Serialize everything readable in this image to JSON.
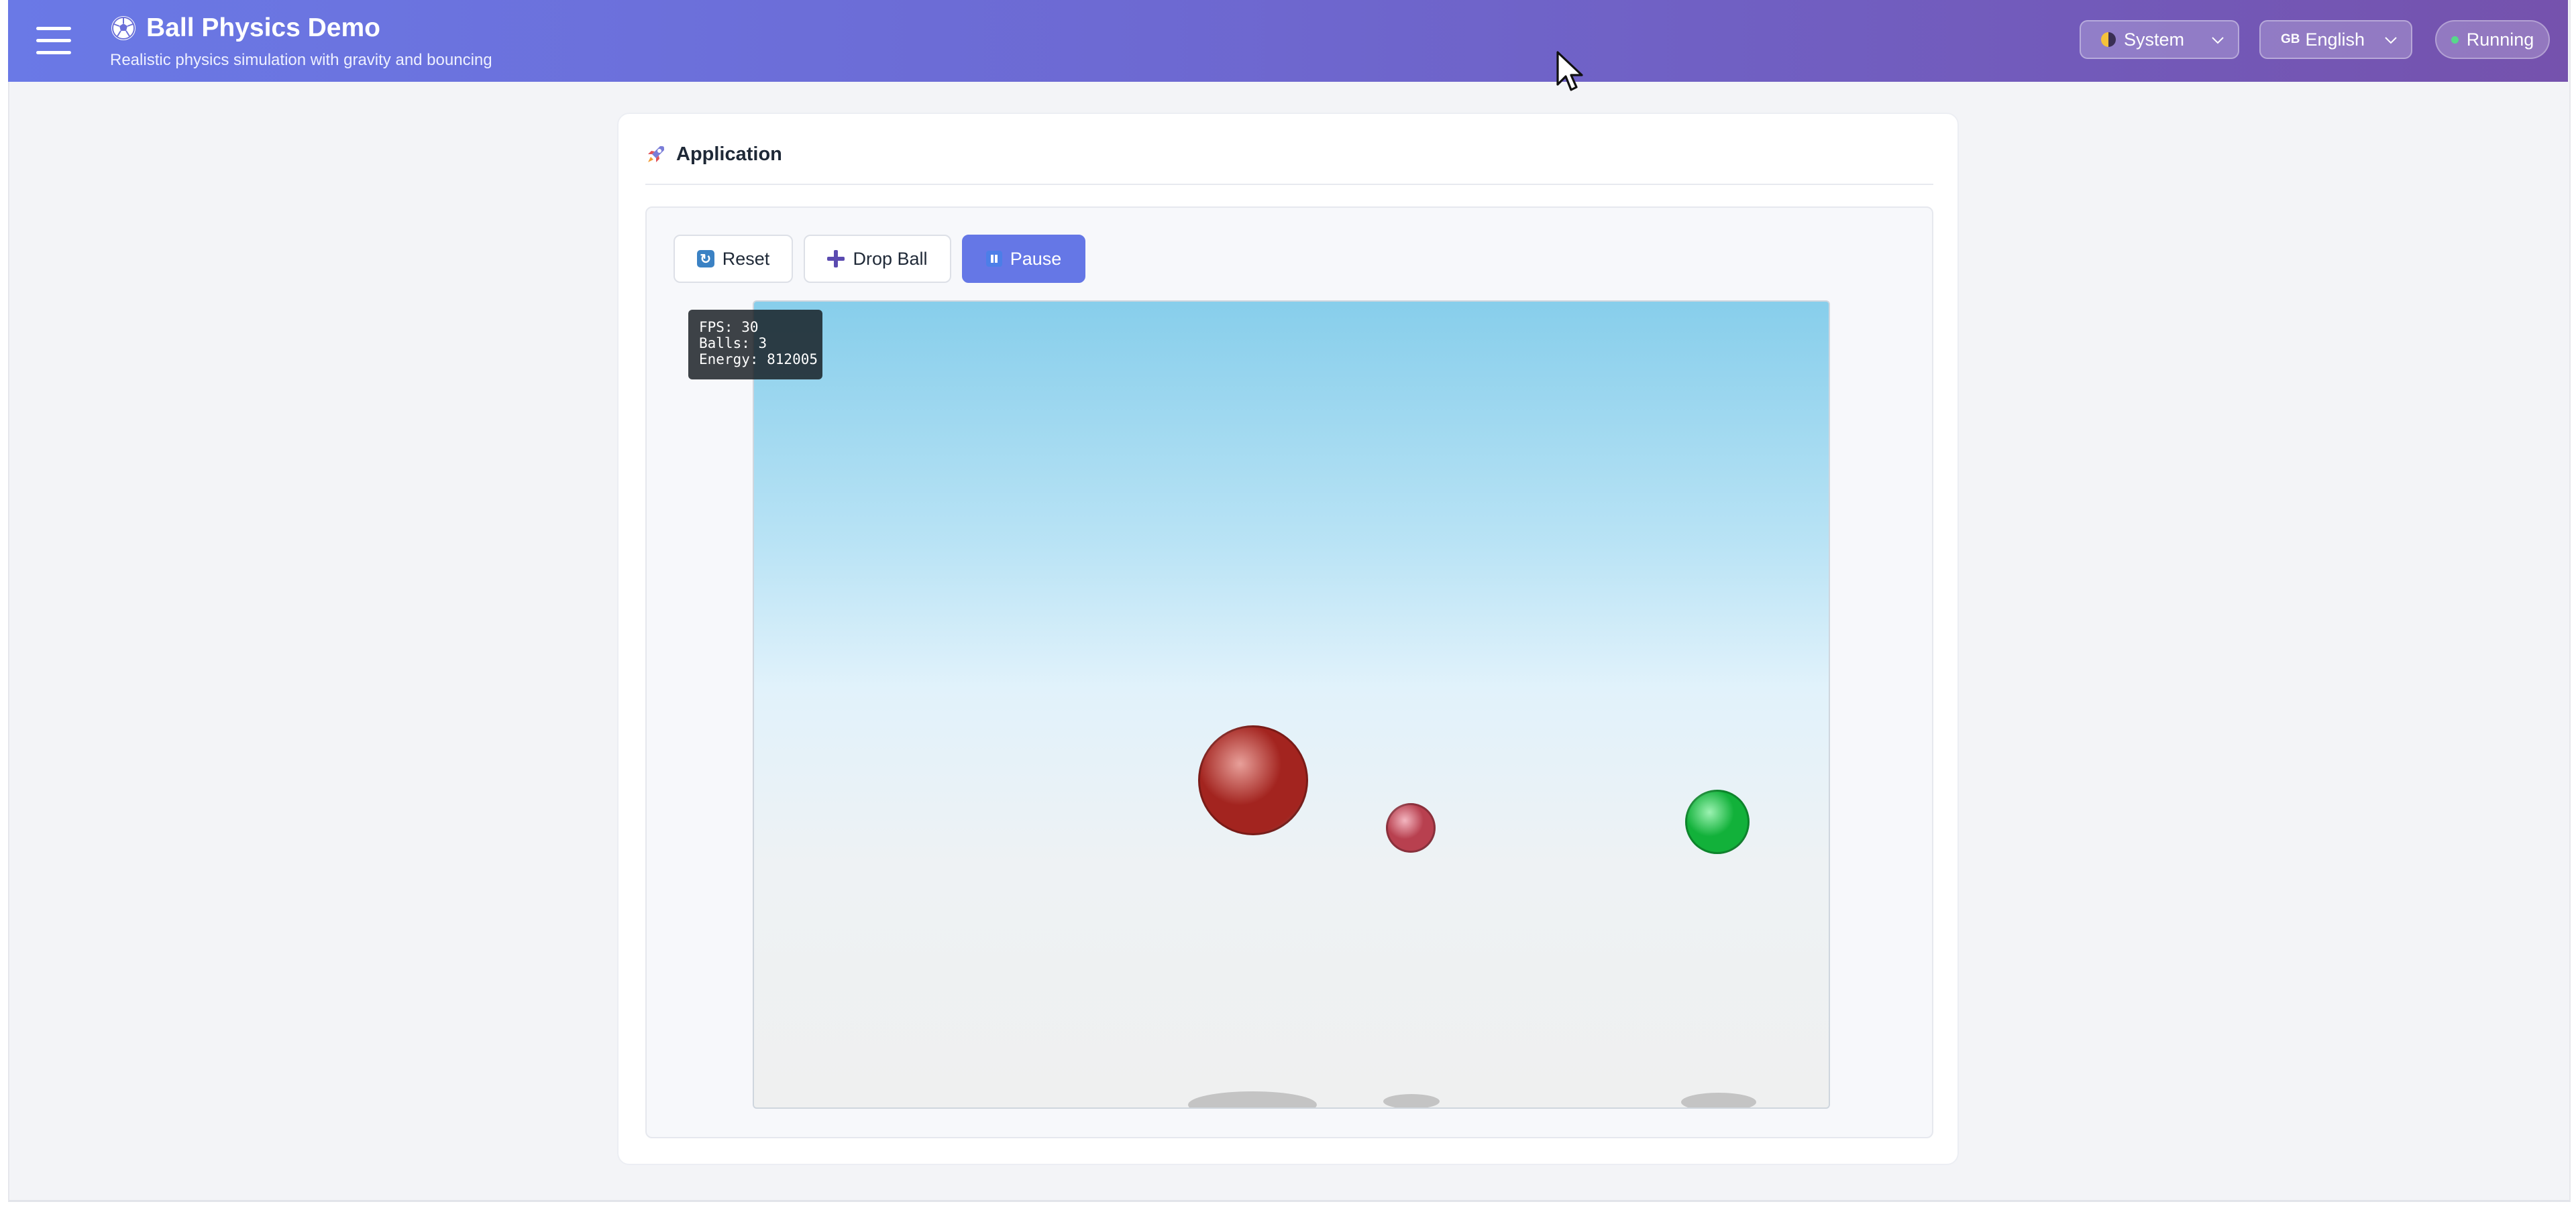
{
  "header": {
    "title": "Ball Physics Demo",
    "subtitle": "Realistic physics simulation with gravity and bouncing",
    "theme_select": {
      "value": "System",
      "icon": "half-moon-icon"
    },
    "language_select": {
      "value": "English",
      "flag": "GB"
    },
    "status": "Running"
  },
  "card": {
    "title": "Application",
    "title_icon": "rocket-icon"
  },
  "toolbar": {
    "reset_label": "Reset",
    "drop_ball_label": "Drop Ball",
    "pause_label": "Pause"
  },
  "simulation": {
    "stats": {
      "fps_line": "FPS: 30",
      "balls_line": "Balls: 3",
      "energy_line": "Energy: 812005"
    },
    "balls": [
      {
        "color": "#a3241f",
        "highlight": "#e8a09a"
      },
      {
        "color": "#b8404f",
        "highlight": "#f3b6c0"
      },
      {
        "color": "#12b13a",
        "highlight": "#9cf2b2"
      }
    ]
  },
  "colors": {
    "header_start": "#6a79e6",
    "header_end": "#7552ad",
    "primary_button": "#6577e6",
    "sky_top": "#87ceeb"
  }
}
